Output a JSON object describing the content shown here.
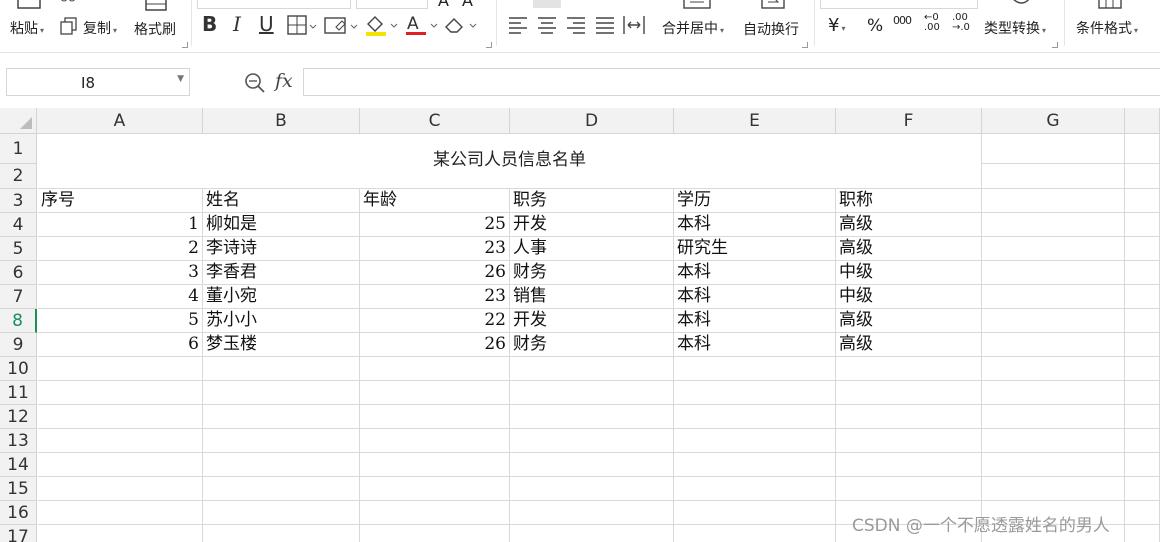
{
  "ribbon": {
    "paste": "粘贴",
    "copy": "复制",
    "format_painter": "格式刷",
    "merge_center": "合并居中",
    "wrap_text": "自动换行",
    "currency_symbol": "¥",
    "percent_symbol": "%",
    "thousands_symbol": "000",
    "decimal_increase": "←0 .00",
    "decimal_decrease": ".00 →.0",
    "type_convert": "类型转换",
    "conditional_format": "条件格式",
    "bold": "B",
    "italic": "I",
    "underline": "U",
    "font_color_letter": "A",
    "accent_yellow": "#f5e200",
    "accent_red": "#e02020"
  },
  "formula_bar": {
    "name_box": "I8",
    "fx_label": "fx",
    "formula": ""
  },
  "columns": [
    "A",
    "B",
    "C",
    "D",
    "E",
    "F",
    "G"
  ],
  "rows": [
    "1",
    "2",
    "3",
    "4",
    "5",
    "6",
    "7",
    "8",
    "9",
    "10",
    "11",
    "12",
    "13",
    "14",
    "15",
    "16",
    "17"
  ],
  "selected_row": "8",
  "sheet": {
    "title": "某公司人员信息名单",
    "headers": [
      "序号",
      "姓名",
      "年龄",
      "职务",
      "学历",
      "职称"
    ],
    "records": [
      [
        "1",
        "柳如是",
        "25",
        "开发",
        "本科",
        "高级"
      ],
      [
        "2",
        "李诗诗",
        "23",
        "人事",
        "研究生",
        "高级"
      ],
      [
        "3",
        "李香君",
        "26",
        "财务",
        "本科",
        "中级"
      ],
      [
        "4",
        "董小宛",
        "23",
        "销售",
        "本科",
        "中级"
      ],
      [
        "5",
        "苏小小",
        "22",
        "开发",
        "本科",
        "高级"
      ],
      [
        "6",
        "梦玉楼",
        "26",
        "财务",
        "本科",
        "高级"
      ]
    ]
  },
  "watermark": "CSDN @一个不愿透露姓名的男人"
}
